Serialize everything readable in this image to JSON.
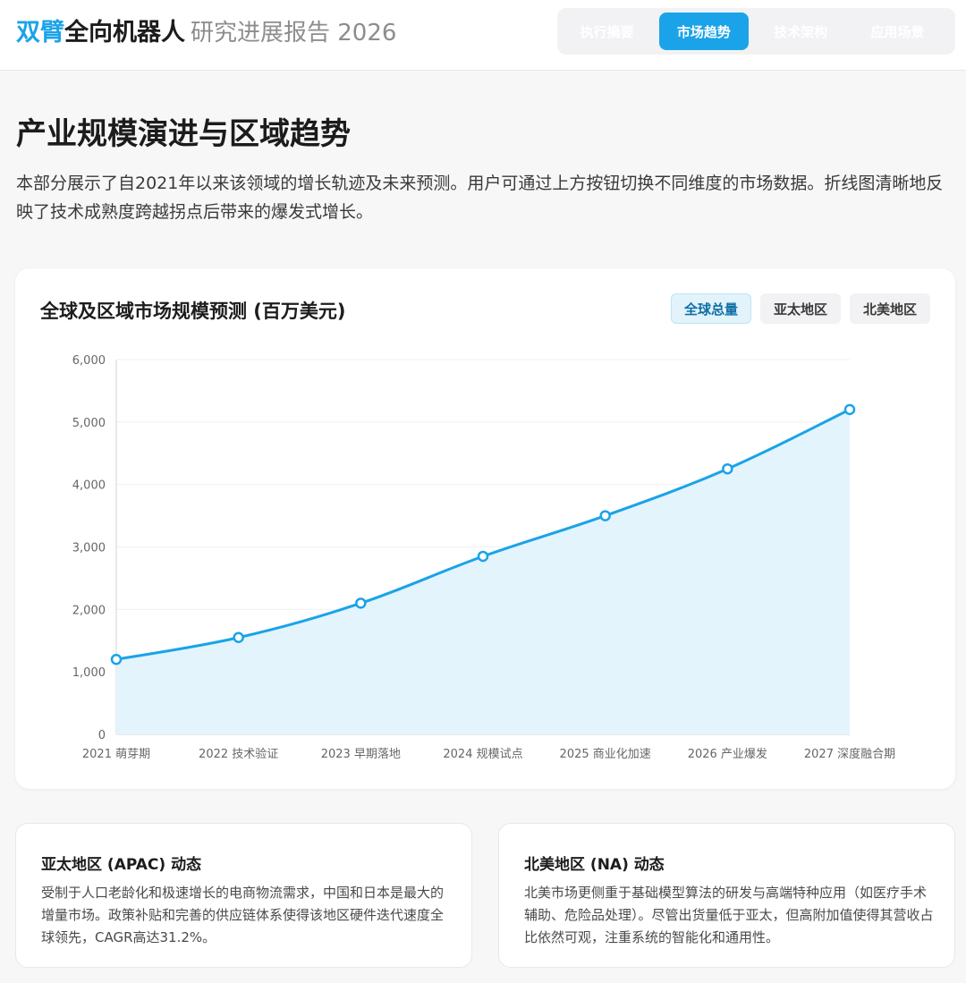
{
  "header": {
    "brand_accent": "双臂",
    "brand_main": "全向机器人",
    "brand_sub": "研究进展报告 2026",
    "tabs": [
      {
        "label": "执行摘要",
        "active": false
      },
      {
        "label": "市场趋势",
        "active": true
      },
      {
        "label": "技术架构",
        "active": false
      },
      {
        "label": "应用场景",
        "active": false
      }
    ]
  },
  "section": {
    "title": "产业规模演进与区域趋势",
    "description": "本部分展示了自2021年以来该领域的增长轨迹及未来预测。用户可通过上方按钮切换不同维度的市场数据。折线图清晰地反映了技术成熟度跨越拐点后带来的爆发式增长。"
  },
  "chart_card": {
    "title": "全球及区域市场规模预测 (百万美元)",
    "filters": [
      {
        "label": "全球总量",
        "active": true
      },
      {
        "label": "亚太地区",
        "active": false
      },
      {
        "label": "北美地区",
        "active": false
      }
    ]
  },
  "chart_data": {
    "type": "area",
    "categories": [
      "2021 萌芽期",
      "2022 技术验证",
      "2023 早期落地",
      "2024 规模试点",
      "2025 商业化加速",
      "2026 产业爆发",
      "2027 深度融合期"
    ],
    "series": [
      {
        "values": [
          1200,
          1550,
          2100,
          2850,
          3500,
          4250,
          5200
        ]
      }
    ],
    "ylim": [
      0,
      6000
    ],
    "yticks": [
      "0",
      "1,000",
      "2,000",
      "3,000",
      "4,000",
      "5,000",
      "6,000"
    ],
    "grid": true,
    "colors": {
      "line": "#1aa3e8",
      "fill": "#e3f4fc"
    }
  },
  "regions": {
    "apac": {
      "title": "亚太地区 (APAC) 动态",
      "text": "受制于人口老龄化和极速增长的电商物流需求，中国和日本是最大的增量市场。政策补贴和完善的供应链体系使得该地区硬件迭代速度全球领先，CAGR高达31.2%。"
    },
    "na": {
      "title": "北美地区 (NA) 动态",
      "text": "北美市场更侧重于基础模型算法的研发与高端特种应用（如医疗手术辅助、危险品处理）。尽管出货量低于亚太，但高附加值使得其营收占比依然可观，注重系统的智能化和通用性。"
    }
  }
}
